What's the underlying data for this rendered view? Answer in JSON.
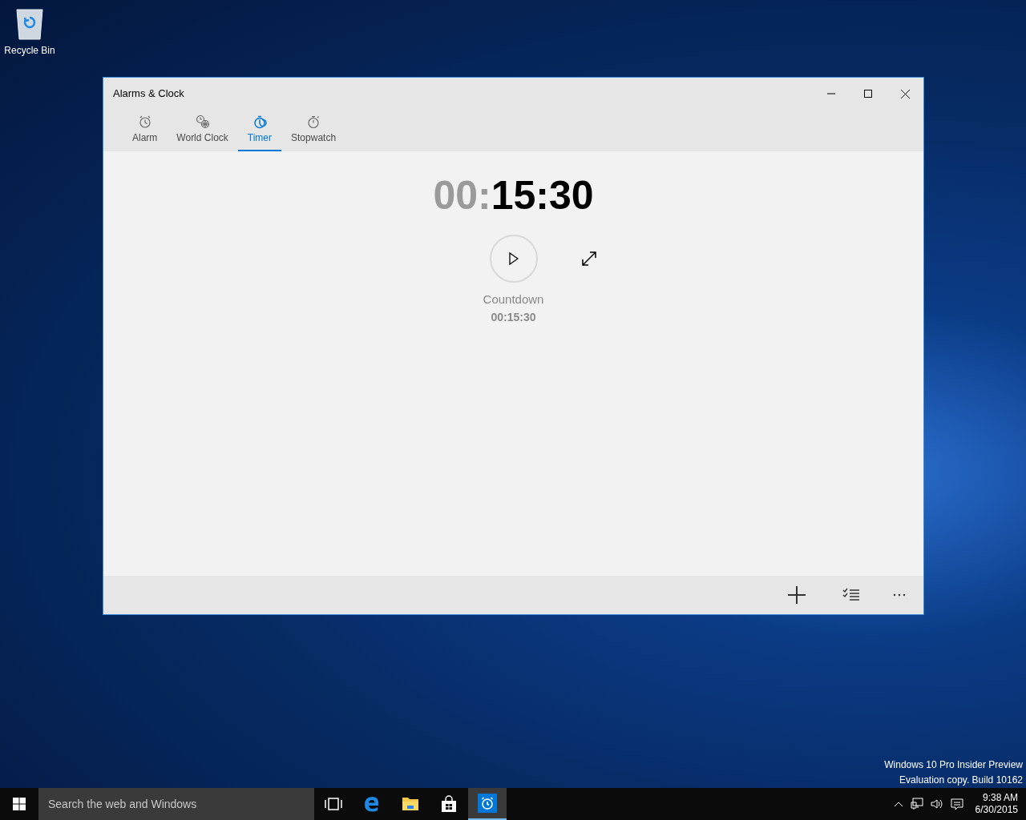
{
  "desktop_icons": [
    {
      "label": "Recycle Bin"
    }
  ],
  "window": {
    "title": "Alarms & Clock"
  },
  "tabs": [
    {
      "label": "Alarm",
      "kind": "alarm",
      "selected": false
    },
    {
      "label": "World Clock",
      "kind": "world",
      "selected": false
    },
    {
      "label": "Timer",
      "kind": "timer",
      "selected": true
    },
    {
      "label": "Stopwatch",
      "kind": "stopwatch",
      "selected": false
    }
  ],
  "timer": {
    "segments": [
      {
        "text": "00",
        "dimmed": true
      },
      {
        "text": ":",
        "dimmed": true
      },
      {
        "text": "15",
        "dimmed": false
      },
      {
        "text": ":",
        "dimmed": false
      },
      {
        "text": "30",
        "dimmed": false
      }
    ],
    "name": "Countdown",
    "duration": "00:15:30"
  },
  "evaluation_notice": [
    "Windows 10 Pro Insider Preview",
    "Evaluation copy. Build 10162"
  ],
  "taskbar": {
    "search": {
      "placeholder": "Search the web and Windows"
    },
    "apps": [
      {
        "kind": "task-view",
        "selected": false
      },
      {
        "kind": "browser",
        "selected": false
      },
      {
        "kind": "explorer",
        "selected": false
      },
      {
        "kind": "store",
        "selected": false
      },
      {
        "kind": "alarms",
        "selected": true
      }
    ],
    "clock": {
      "time": "9:38 AM",
      "date": "6/30/2015"
    }
  }
}
